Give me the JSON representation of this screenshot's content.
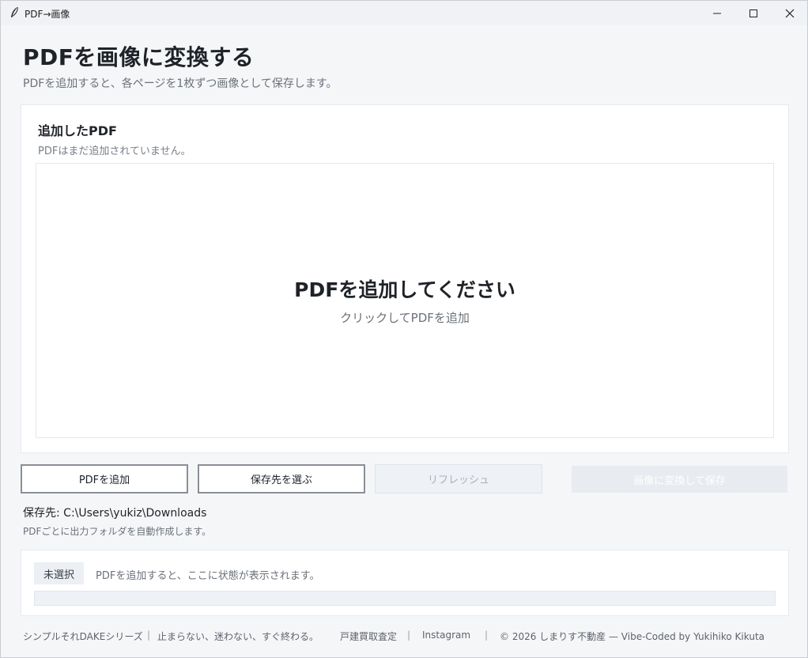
{
  "window": {
    "title": "PDF→画像",
    "minimize": "minimize",
    "maximize": "maximize",
    "close": "close"
  },
  "header": {
    "title": "PDFを画像に変換する",
    "subtitle": "PDFを追加すると、各ページを1枚ずつ画像として保存します。"
  },
  "pdf_panel": {
    "heading": "追加したPDF",
    "status": "PDFはまだ追加されていません。",
    "drop_title": "PDFを追加してください",
    "drop_hint": "クリックしてPDFを追加"
  },
  "toolbar": {
    "add_pdf": "PDFを追加",
    "choose_dest": "保存先を選ぶ",
    "refresh": "リフレッシュ",
    "convert_save": "画像に変換して保存"
  },
  "save": {
    "path": "保存先: C:\\Users\\yukiz\\Downloads",
    "note": "PDFごとに出力フォルダを自動作成します。"
  },
  "status": {
    "badge": "未選択",
    "message": "PDFを追加すると、ここに状態が表示されます。",
    "progress": 0
  },
  "footer": {
    "series": "シンプルそれDAKEシリーズ",
    "tagline": "止まらない、迷わない、すぐ終わる。",
    "link1": "戸建買取査定",
    "link2": "Instagram",
    "copyright": "© 2026 しまりす不動産 — Vibe-Coded by Yukihiko Kikuta",
    "separator": "|"
  },
  "colors": {
    "accent": "#5b8def",
    "background": "#f5f6f8",
    "card": "#ffffff"
  }
}
